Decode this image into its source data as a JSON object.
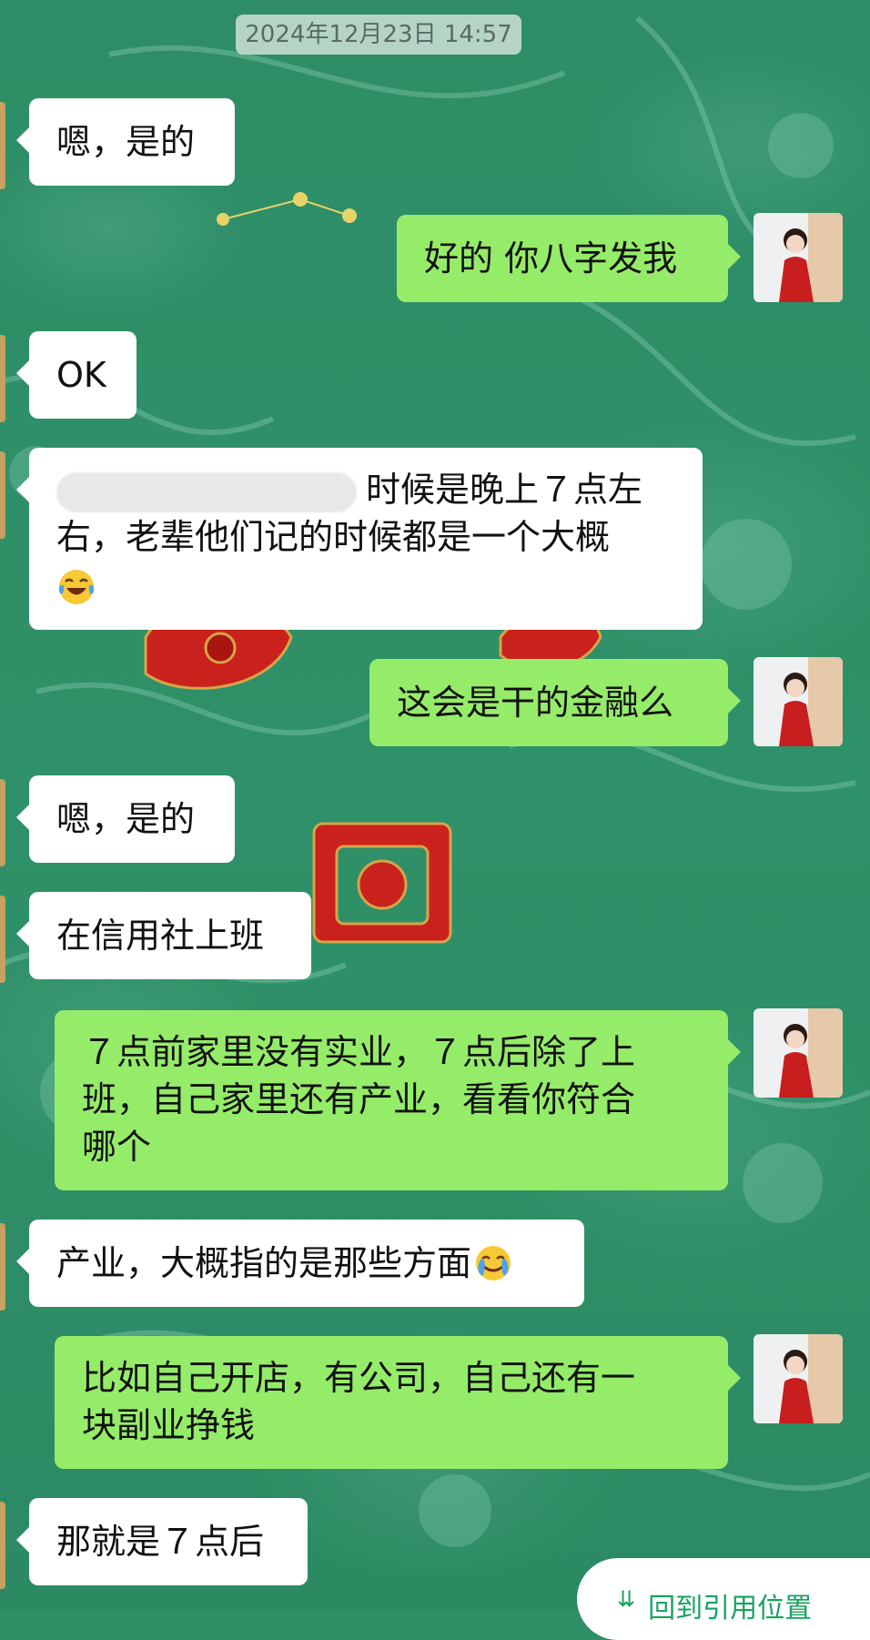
{
  "chat": {
    "timestamp": "2024年12月23日 14:57",
    "messages": [
      {
        "side": "left",
        "text": "嗯，是的"
      },
      {
        "side": "right",
        "text": "好的 你八字发我"
      },
      {
        "side": "left",
        "text": "OK"
      },
      {
        "side": "left",
        "line1": "时候是晚上７点左",
        "line2": "右，老辈他们记的时候都是一个大概",
        "emoji": "laughing-tears"
      },
      {
        "side": "right",
        "text": "这会是干的金融么"
      },
      {
        "side": "left",
        "text": "嗯，是的"
      },
      {
        "side": "left",
        "text": "在信用社上班"
      },
      {
        "side": "right",
        "line1": "７点前家里没有实业，７点后除了上",
        "line2": "班，自己家里还有产业，看看你符合",
        "line3": "哪个"
      },
      {
        "side": "left",
        "text": "产业，大概指的是那些方面",
        "emoji": "face-with-tears"
      },
      {
        "side": "right",
        "line1": "比如自己开店，有公司，自己还有一",
        "line2": "块副业挣钱"
      },
      {
        "side": "left",
        "text": "那就是７点后"
      }
    ],
    "back_to_quote_label": "回到引用位置"
  },
  "colors": {
    "background": "#2f8f67",
    "self_bubble": "#95ec69",
    "other_bubble": "#ffffff",
    "accent": "#16a35e"
  }
}
